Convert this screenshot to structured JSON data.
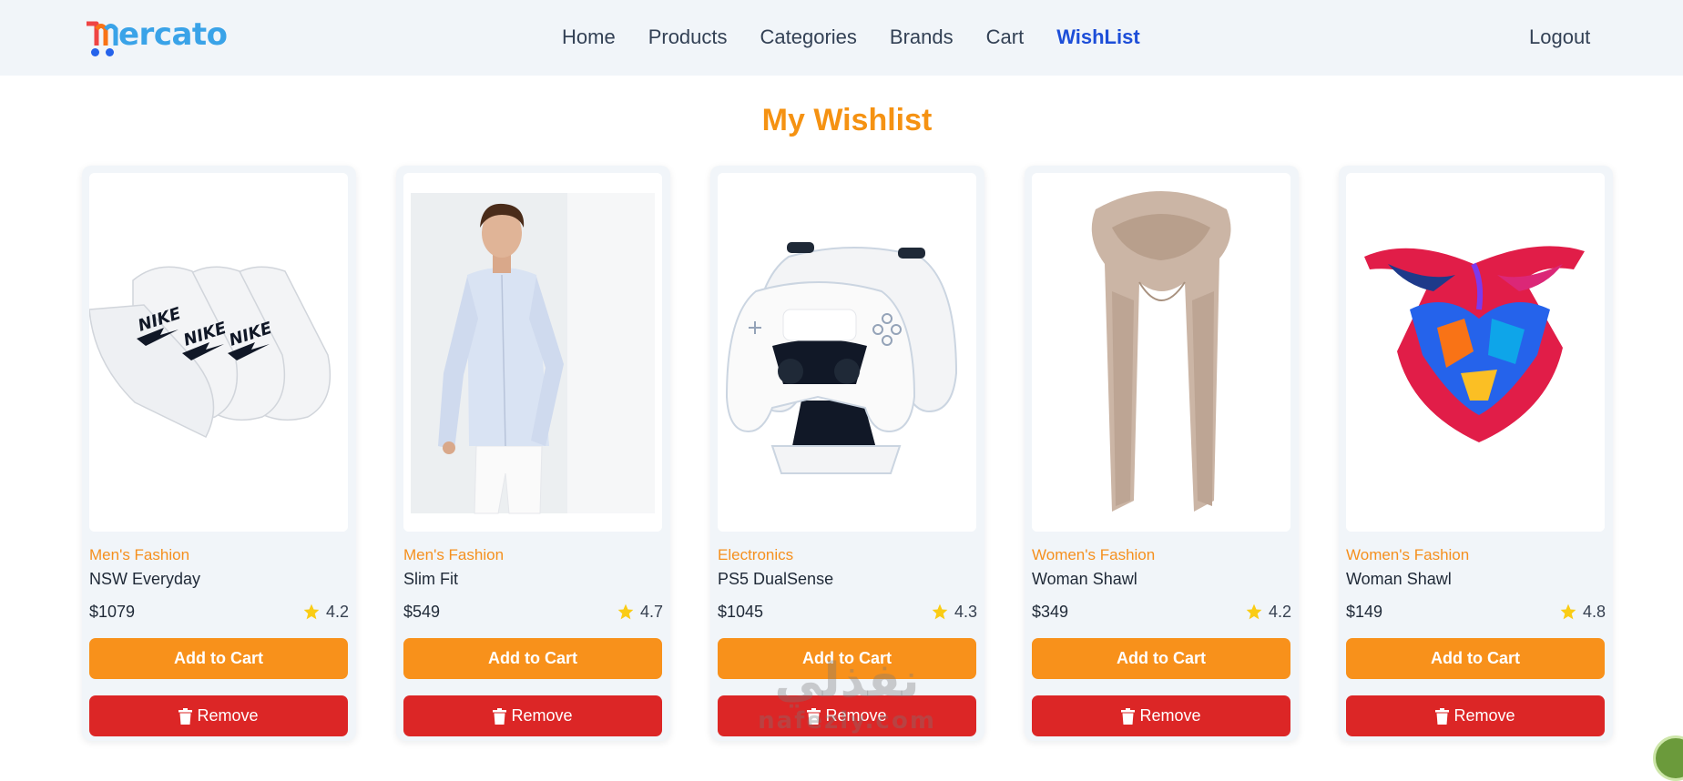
{
  "navbar": {
    "logo_text": "ercato",
    "links": [
      {
        "label": "Home"
      },
      {
        "label": "Products"
      },
      {
        "label": "Categories"
      },
      {
        "label": "Brands"
      },
      {
        "label": "Cart"
      },
      {
        "label": "WishList",
        "active": true
      }
    ],
    "logout_label": "Logout"
  },
  "page": {
    "title": "My Wishlist"
  },
  "products": [
    {
      "category": "Men's Fashion",
      "name": "NSW Everyday",
      "price": "$1079",
      "rating": "4.2",
      "image": "socks-image",
      "add_label": "Add to Cart",
      "remove_label": "Remove"
    },
    {
      "category": "Men's Fashion",
      "name": "Slim Fit",
      "price": "$549",
      "rating": "4.7",
      "image": "shirt-model-image",
      "add_label": "Add to Cart",
      "remove_label": "Remove"
    },
    {
      "category": "Electronics",
      "name": "PS5 DualSense",
      "price": "$1045",
      "rating": "4.3",
      "image": "controller-image",
      "add_label": "Add to Cart",
      "remove_label": "Remove"
    },
    {
      "category": "Women's Fashion",
      "name": "Woman Shawl",
      "price": "$349",
      "rating": "4.2",
      "image": "beige-shawl-image",
      "add_label": "Add to Cart",
      "remove_label": "Remove"
    },
    {
      "category": "Women's Fashion",
      "name": "Woman Shawl",
      "price": "$149",
      "rating": "4.8",
      "image": "colorful-scarf-image",
      "add_label": "Add to Cart",
      "remove_label": "Remove"
    }
  ],
  "watermark": {
    "arabic": "نفذلي",
    "latin": "nafezly.com"
  },
  "colors": {
    "brand_blue": "#3aa3e8",
    "accent_orange": "#f8911b",
    "danger_red": "#dc2626",
    "active_link": "#1d4ed8",
    "star_yellow": "#facc15"
  }
}
